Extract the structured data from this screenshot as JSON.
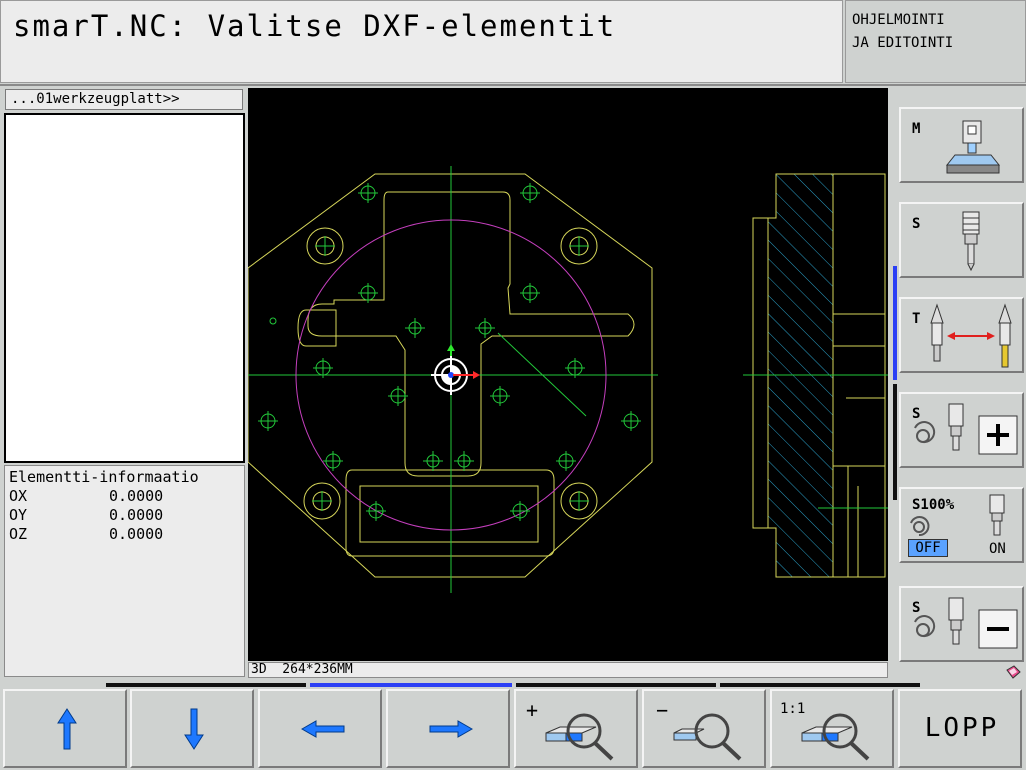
{
  "header": {
    "title": "smarT.NC: Valitse DXF-elementit",
    "mode_line1": "OHJELMOINTI",
    "mode_line2": "JA EDITOINTI"
  },
  "left_panel": {
    "file_tab": "...01werkzeugplatt>>",
    "info": {
      "title": "Elementti-informaatio",
      "rows": [
        {
          "label": "OX",
          "value": "0.0000"
        },
        {
          "label": "OY",
          "value": "0.0000"
        },
        {
          "label": "OZ",
          "value": "0.0000"
        }
      ]
    }
  },
  "canvas": {
    "status": "3D  264*236MM",
    "colors": {
      "background": "#000000",
      "outline": "#d6d65a",
      "center_lines": "#22c83a",
      "circle": "#c43fbd",
      "hatch": "#2aa0c8"
    }
  },
  "side_buttons": {
    "m_label": "M",
    "s_label": "S",
    "t_label": "T",
    "s_plus_label": "S",
    "s100_label": "S100%",
    "s100_off": "OFF",
    "s100_on": "ON",
    "s_minus_label": "S"
  },
  "softkeys": {
    "up_icon": "arrow-up-icon",
    "down_icon": "arrow-down-icon",
    "left_icon": "arrow-left-icon",
    "right_icon": "arrow-right-icon",
    "zoom_in_label": "+",
    "zoom_out_label": "−",
    "zoom_1to1_label": "1:1",
    "lopp_label": "LOPP"
  },
  "colors": {
    "accent_blue": "#1e78ff",
    "toggle_off": "#5aa2ff"
  }
}
